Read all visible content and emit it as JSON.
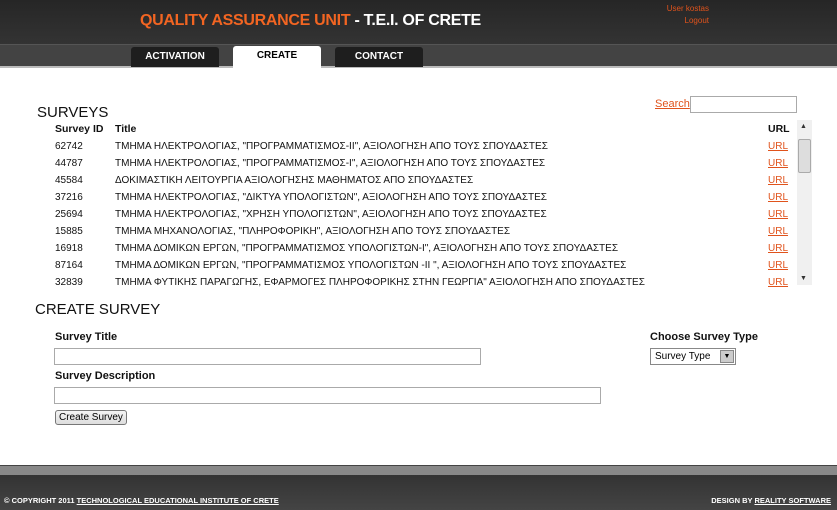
{
  "header": {
    "title_accent": "QUALITY ASSURANCE UNIT",
    "title_rest": " - T.E.I. OF CRETE",
    "user": "User kostas",
    "logout": "Logout"
  },
  "nav": {
    "tabs": [
      {
        "label": "ACTIVATION"
      },
      {
        "label": "CREATE",
        "active": true
      },
      {
        "label": "CONTACT"
      }
    ]
  },
  "surveys": {
    "heading": "SURVEYS",
    "search_label": "Search",
    "search_value": "",
    "columns": [
      "Survey ID",
      "Title",
      "URL"
    ],
    "rows": [
      {
        "id": "62742",
        "title": "ΤΜΗΜΑ ΗΛΕΚΤΡΟΛΟΓΙΑΣ, \"ΠΡΟΓΡΑΜΜΑΤΙΣΜΟΣ-ΙΙ\", ΑΞΙΟΛΟΓΗΣΗ ΑΠΟ ΤΟΥΣ ΣΠΟΥΔΑΣΤΕΣ",
        "url": "URL"
      },
      {
        "id": "44787",
        "title": "ΤΜΗΜΑ ΗΛΕΚΤΡΟΛΟΓΙΑΣ, \"ΠΡΟΓΡΑΜΜΑΤΙΣΜΟΣ-Ι\", ΑΞΙΟΛΟΓΗΣΗ ΑΠΟ ΤΟΥΣ ΣΠΟΥΔΑΣΤΕΣ",
        "url": "URL"
      },
      {
        "id": "45584",
        "title": "ΔΟΚΙΜΑΣΤΙΚΗ ΛΕΙΤΟΥΡΓΙΑ ΑΞΙΟΛΟΓΗΣΗΣ ΜΑΘΗΜΑΤΟΣ ΑΠΟ ΣΠΟΥΔΑΣΤΕΣ",
        "url": "URL"
      },
      {
        "id": "37216",
        "title": "ΤΜΗΜΑ ΗΛΕΚΤΡΟΛΟΓΙΑΣ, \"ΔΙΚΤΥΑ ΥΠΟΛΟΓΙΣΤΩΝ\", ΑΞΙΟΛΟΓΗΣΗ ΑΠΟ ΤΟΥΣ ΣΠΟΥΔΑΣΤΕΣ",
        "url": "URL"
      },
      {
        "id": "25694",
        "title": "ΤΜΗΜΑ ΗΛΕΚΤΡΟΛΟΓΙΑΣ, \"ΧΡΗΣΗ ΥΠΟΛΟΓΙΣΤΩΝ\", ΑΞΙΟΛΟΓΗΣΗ ΑΠΟ ΤΟΥΣ ΣΠΟΥΔΑΣΤΕΣ",
        "url": "URL"
      },
      {
        "id": "15885",
        "title": "ΤΜΗΜΑ ΜΗΧΑΝΟΛΟΓΙΑΣ, \"ΠΛΗΡΟΦΟΡΙΚΗ\", ΑΞΙΟΛΟΓΗΣΗ ΑΠΟ ΤΟΥΣ ΣΠΟΥΔΑΣΤΕΣ",
        "url": "URL"
      },
      {
        "id": "16918",
        "title": "ΤΜΗΜΑ ΔΟΜΙΚΩΝ ΕΡΓΩΝ, \"ΠΡΟΓΡΑΜΜΑΤΙΣΜΟΣ ΥΠΟΛΟΓΙΣΤΩΝ-Ι\", ΑΞΙΟΛΟΓΗΣΗ ΑΠΟ ΤΟΥΣ ΣΠΟΥΔΑΣΤΕΣ",
        "url": "URL"
      },
      {
        "id": "87164",
        "title": "ΤΜΗΜΑ ΔΟΜΙΚΩΝ ΕΡΓΩΝ, \"ΠΡΟΓΡΑΜΜΑΤΙΣΜΟΣ ΥΠΟΛΟΓΙΣΤΩΝ -ΙΙ \", ΑΞΙΟΛΟΓΗΣΗ ΑΠΟ ΤΟΥΣ ΣΠΟΥΔΑΣΤΕΣ",
        "url": "URL"
      },
      {
        "id": "32839",
        "title": "ΤΜΗΜΑ ΦΥΤΙΚΗΣ ΠΑΡΑΓΩΓΗΣ, ΕΦΑΡΜΟΓΕΣ ΠΛΗΡΟΦΟΡΙΚΗΣ ΣΤΗΝ ΓΕΩΡΓΙΑ\" ΑΞΙΟΛΟΓΗΣΗ ΑΠΟ ΣΠΟΥΔΑΣΤΕΣ",
        "url": "URL"
      }
    ]
  },
  "create": {
    "heading": "CREATE SURVEY",
    "title_label": "Survey Title",
    "title_value": "",
    "desc_label": "Survey Description",
    "desc_value": "",
    "type_label": "Choose Survey Type",
    "type_selected": "Survey Type",
    "button": "Create Survey"
  },
  "footer": {
    "copyright": "© COPYRIGHT 2011 ",
    "institute": "TECHNOLOGICAL EDUCATIONAL INSTITUTE OF CRETE",
    "design_by": "DESIGN BY ",
    "designer": "REALITY SOFTWARE"
  },
  "colors": {
    "accent": "#f26522",
    "header_bg": "#2b2b2b"
  }
}
